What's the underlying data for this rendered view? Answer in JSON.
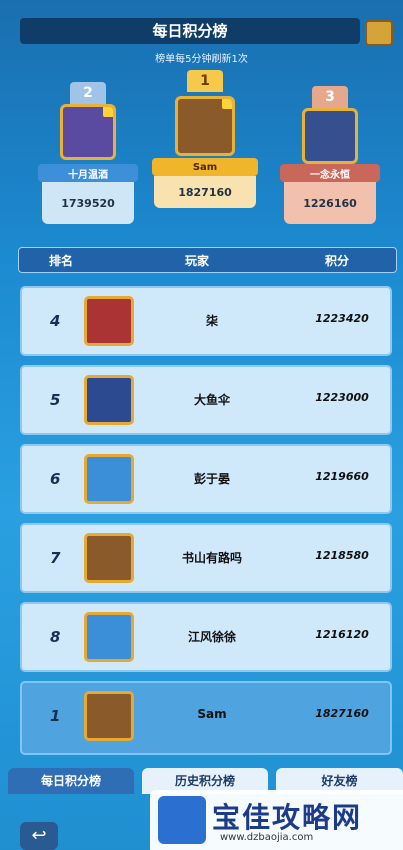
{
  "header": {
    "title": "每日积分榜",
    "subtitle": "榜单每5分钟刷新1次"
  },
  "podium": [
    {
      "rank": "2",
      "name": "十月温酒",
      "score": "1739520"
    },
    {
      "rank": "1",
      "name": "Sam",
      "score": "1827160"
    },
    {
      "rank": "3",
      "name": "一念永恒",
      "score": "1226160"
    }
  ],
  "columns": {
    "rank": "排名",
    "player": "玩家",
    "score": "积分"
  },
  "rows": [
    {
      "rank": "4",
      "name": "柒",
      "score": "1223420"
    },
    {
      "rank": "5",
      "name": "大鱼伞",
      "score": "1223000"
    },
    {
      "rank": "6",
      "name": "彭于晏",
      "score": "1219660"
    },
    {
      "rank": "7",
      "name": "书山有路吗",
      "score": "1218580"
    },
    {
      "rank": "8",
      "name": "江风徐徐",
      "score": "1216120"
    }
  ],
  "self": {
    "rank": "1",
    "name": "Sam",
    "score": "1827160"
  },
  "tabs": {
    "daily": "每日积分榜",
    "history": "历史积分榜",
    "friends": "好友榜"
  },
  "watermark": {
    "text": "宝佳攻略网",
    "url": "www.dzbaojia.com"
  },
  "colors": {
    "podium1": "#f6c94a",
    "podium2": "#4aa7e5",
    "podium3": "#e08b74",
    "active_tab": "#2f6db5"
  }
}
